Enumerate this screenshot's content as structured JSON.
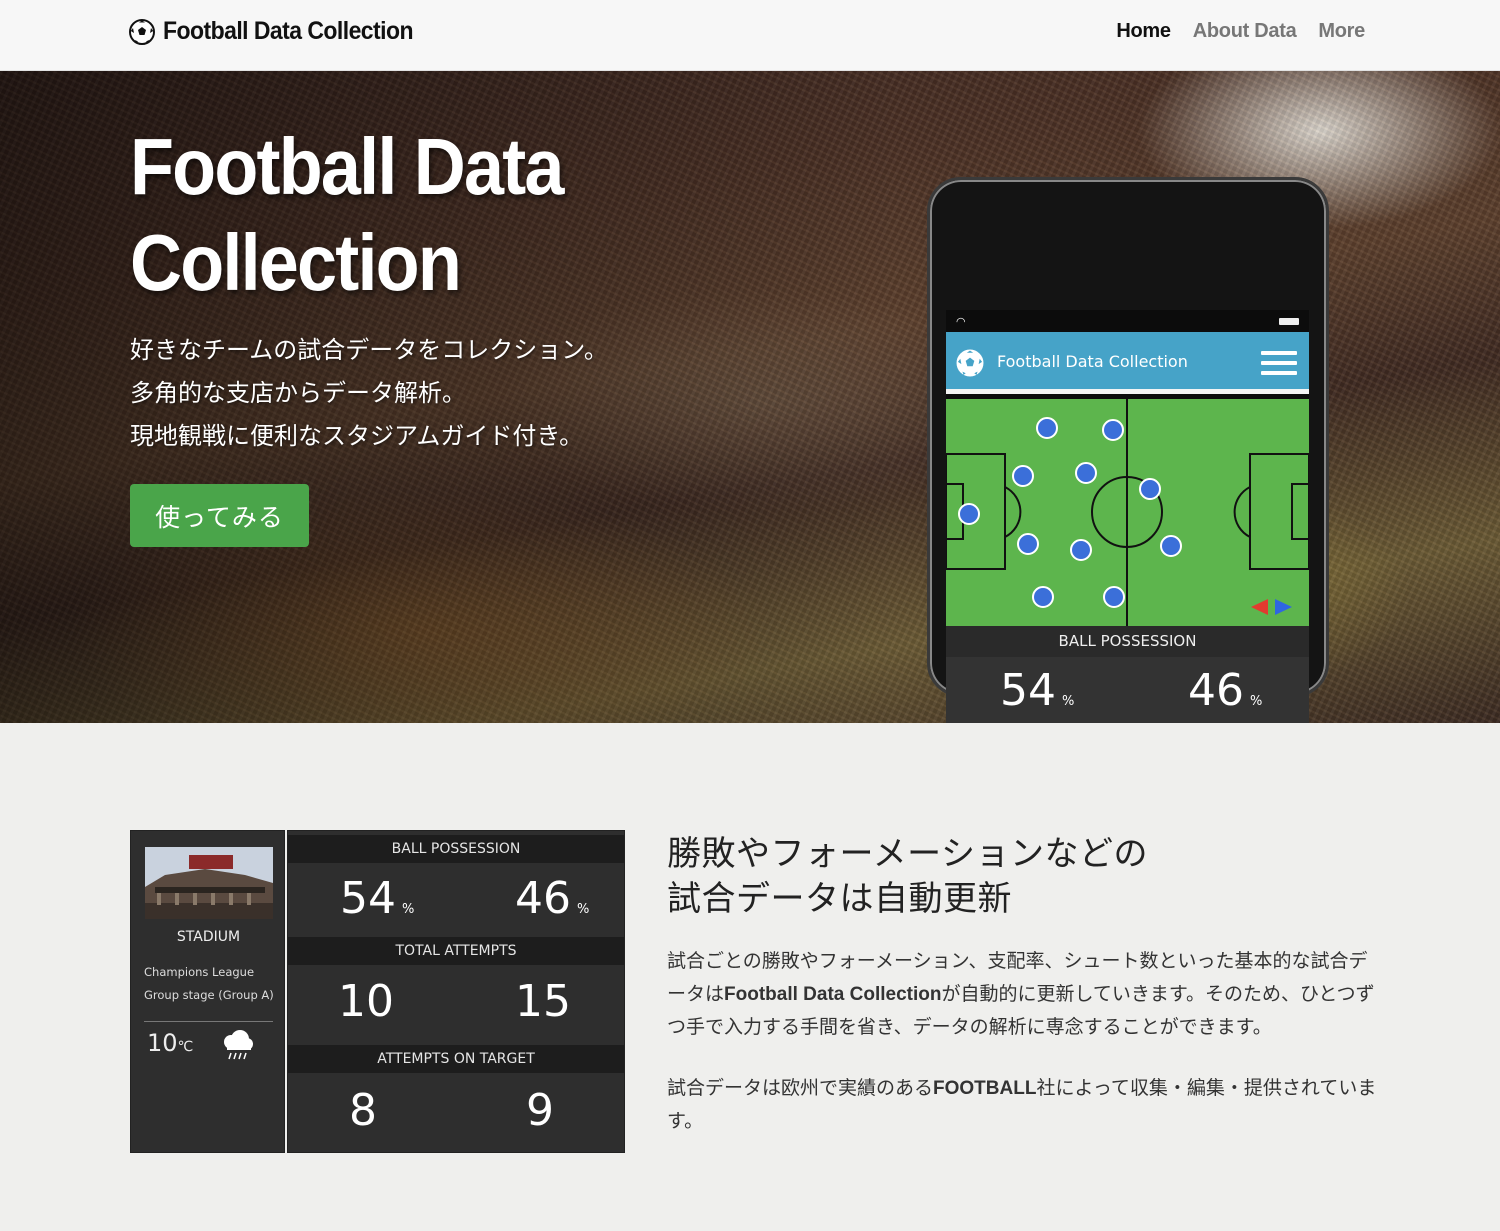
{
  "nav": {
    "brand": "Football Data Collection",
    "links": [
      {
        "label": "Home",
        "active": true
      },
      {
        "label": "About Data",
        "active": false
      },
      {
        "label": "More",
        "active": false
      }
    ]
  },
  "hero": {
    "title_line1": "Football Data",
    "title_line2": "Collection",
    "lines": [
      "好きなチームの試合データをコレクション。",
      "多角的な支店からデータ解析。",
      "現地観戦に便利なスタジアムガイド付き。"
    ],
    "cta": "使ってみる"
  },
  "phone": {
    "app_title": "Football Data Collection",
    "possession_label": "BALL POSSESSION",
    "home_possession": "54",
    "away_possession": "46",
    "unit": "%"
  },
  "stadium": {
    "label": "STADIUM",
    "competition": "Champions League",
    "stage": "Group stage (Group A)",
    "temperature": "10",
    "temp_unit": "℃",
    "weather_icon": "rain-cloud-icon"
  },
  "stats": [
    {
      "label": "BALL POSSESSION",
      "home": "54",
      "away": "46",
      "unit": "%"
    },
    {
      "label": "TOTAL ATTEMPTS",
      "home": "10",
      "away": "15"
    },
    {
      "label": "ATTEMPTS ON TARGET",
      "home": "8",
      "away": "9"
    }
  ],
  "feature": {
    "title_line1": "勝敗やフォーメーションなどの",
    "title_line2": "試合データは自動更新",
    "p1_before": "試合ごとの勝敗やフォーメーション、支配率、シュート数といった基本的な試合データは",
    "p1_bold": "Football Data Collection",
    "p1_after": "が自動的に更新していきます。そのため、ひとつずつ手で入力する手間を省き、データの解析に専念することができます。",
    "p2_before": "試合データは欧州で実績のある",
    "p2_bold": "FOOTBALL",
    "p2_after": "社によって収集・編集・提供されています。"
  },
  "colors": {
    "cta": "#4aa54a",
    "app_bar": "#46a3c8",
    "pitch": "#5db54d",
    "player": "#3b6fd9"
  }
}
